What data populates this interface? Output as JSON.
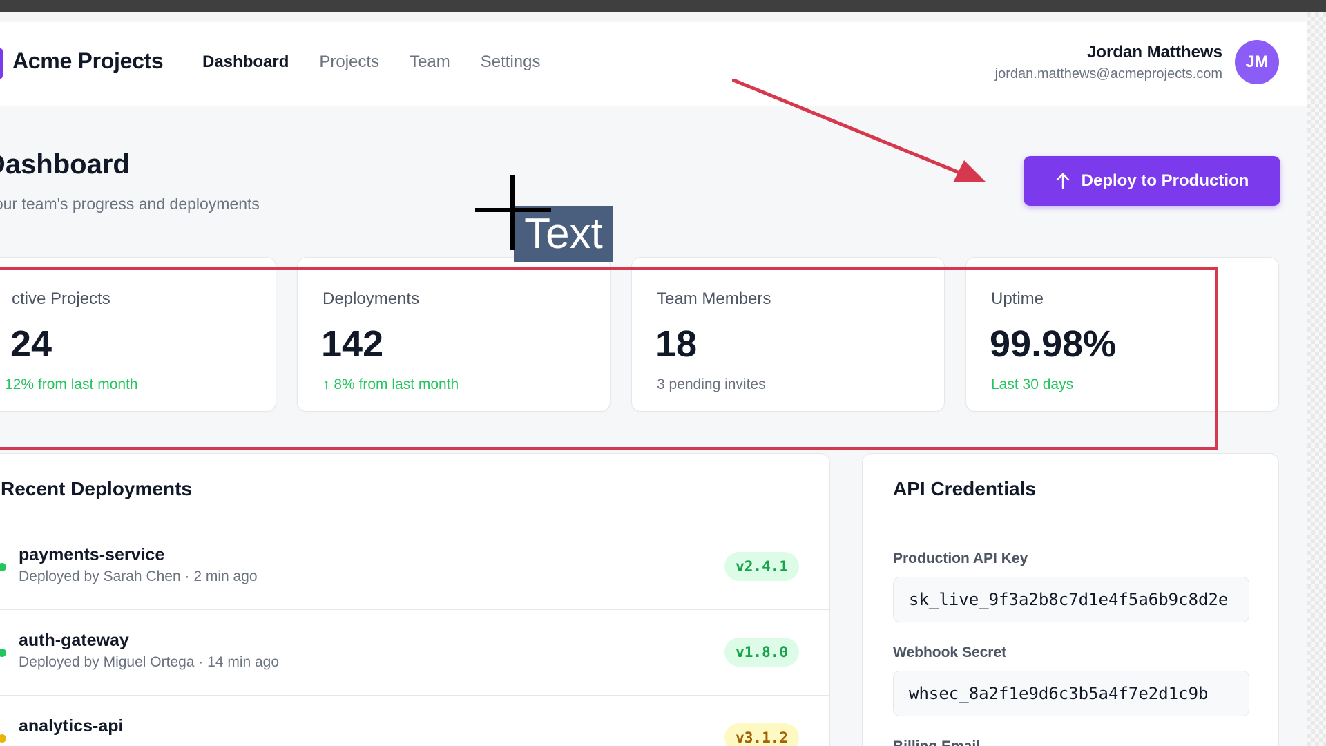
{
  "app": {
    "name": "Acme Projects",
    "accent": "#7c3aed"
  },
  "nav": [
    {
      "label": "Dashboard",
      "active": true
    },
    {
      "label": "Projects",
      "active": false
    },
    {
      "label": "Team",
      "active": false
    },
    {
      "label": "Settings",
      "active": false
    }
  ],
  "user": {
    "name": "Jordan Matthews",
    "email": "jordan.matthews@acmeprojects.com",
    "initials": "JM"
  },
  "page": {
    "title": "am Dashboard",
    "subtitle": "itor your team's progress and deployments",
    "deploy_button": "Deploy to Production",
    "deploy_icon": "arrow-up-icon"
  },
  "stats": [
    {
      "label": "ctive Projects",
      "value": "24",
      "note": "12% from last month",
      "note_status": "good"
    },
    {
      "label": "Deployments",
      "value": "142",
      "note": "↑ 8% from last month",
      "note_status": "good"
    },
    {
      "label": "Team Members",
      "value": "18",
      "note": "3 pending invites",
      "note_status": "neutral"
    },
    {
      "label": "Uptime",
      "value": "99.98%",
      "note": "Last 30 days",
      "note_status": "good"
    }
  ],
  "deployments": {
    "title": "Recent Deployments",
    "rows": [
      {
        "name": "payments-service",
        "meta": "Deployed by Sarah Chen · 2 min ago",
        "version": "v2.4.1",
        "status": "success"
      },
      {
        "name": "auth-gateway",
        "meta": "Deployed by Miguel Ortega · 14 min ago",
        "version": "v1.8.0",
        "status": "success"
      },
      {
        "name": "analytics-api",
        "meta": "",
        "version": "v3.1.2",
        "status": "pending"
      }
    ]
  },
  "credentials": {
    "title": "API Credentials",
    "api_key_label": "Production API Key",
    "api_key_value": "sk_live_9f3a2b8c7d1e4f5a6b9c8d2e",
    "webhook_label": "Webhook Secret",
    "webhook_value": "whsec_8a2f1e9d6c3b5a4f7e2d1c9b",
    "billing_label": "Billing Email"
  },
  "annotation": {
    "text_label": "Text",
    "color": "#d6394d"
  },
  "colors": {
    "good": "#22c55e",
    "pending": "#eab308"
  }
}
